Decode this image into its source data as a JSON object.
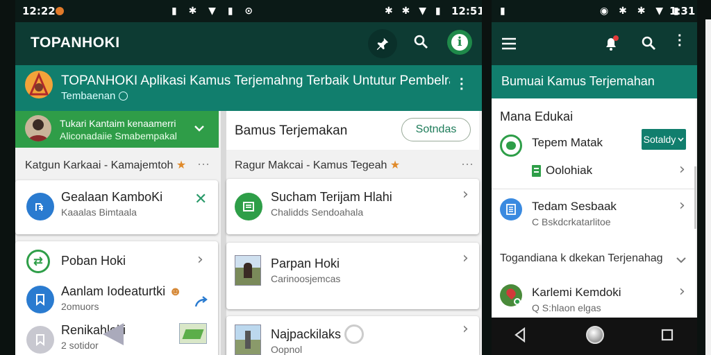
{
  "left_phone": {
    "status": {
      "time": "12:22",
      "right_time": "12:51"
    },
    "toolbar": {
      "title": "TOPANHOKI"
    },
    "banner": {
      "title": "TOPANHOKI Aplikasi Kamus Terjemahng Terbaik Untutur Pembelrakan",
      "subtitle": "Tembaenan"
    },
    "green_card": {
      "line1": "Tukari Kantaim kenaamerri",
      "line2": "Aliconadaiie Smabempakal"
    },
    "left_section": {
      "header": "Katgun Karkaai - Kamajemtoh"
    },
    "left_item1": {
      "title": "Gealaan KamboKi",
      "sub": "Kaaalas Bimtaala"
    },
    "left_list": [
      {
        "title": "Poban Hoki",
        "sub": ""
      },
      {
        "title": "Aanlam Iodeaturtki",
        "sub": "2omuors"
      },
      {
        "title": "Renikahloki",
        "sub": "2 sotidor"
      }
    ],
    "right_col": {
      "header": "Bamus Terjemakan",
      "button": "Sotndas",
      "section": "Ragur Makcai - Kamus Tegeah"
    },
    "right_item1": {
      "title": "Sucham Terijam Hlahi",
      "sub": "Chalidds Sendoahala"
    },
    "right_item2": {
      "title": "Parpan Hoki",
      "sub": "Carinoosjemcas"
    },
    "right_item3": {
      "title": "Najpackilaks",
      "sub": "Oopnol"
    }
  },
  "right_phone": {
    "status": {
      "time": "1:31"
    },
    "banner": {
      "title": "Bumuai Kamus Terjemahan"
    },
    "section1": {
      "title": "Mana Edukai"
    },
    "item1": {
      "title": "Tepem Matak",
      "button": "Sotaldy"
    },
    "item2": {
      "title": "Oolohiak"
    },
    "item3": {
      "title": "Tedam Sesbaak",
      "sub": "C Bskdcrkatarlitoe"
    },
    "section2": {
      "title": "Togandiana k dkekan Terjenahag"
    },
    "item4": {
      "title": "Karlemi Kemdoki",
      "sub": "Q S:hlaon elgas"
    }
  },
  "colors": {
    "teal": "#0e7c6b",
    "dark_teal": "#0d3b33",
    "green": "#2e9e48",
    "blue": "#2a7bd0"
  }
}
